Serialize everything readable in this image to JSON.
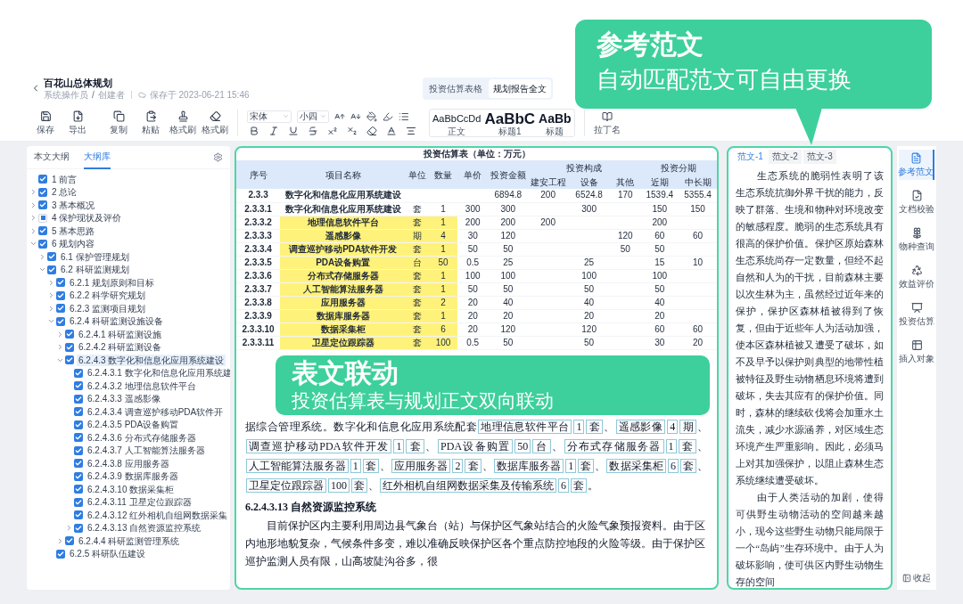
{
  "header": {
    "title": "百花山总体规划",
    "author": "系统操作员",
    "separator": "/",
    "role": "创建者",
    "saved": "保存于 2023-06-21 15:46"
  },
  "view_tabs": [
    {
      "label": "投资估算表格",
      "selected": false
    },
    {
      "label": "规划报告全文",
      "selected": true
    }
  ],
  "toolbar": {
    "buttons": [
      {
        "label": "保存",
        "kind": "save"
      },
      {
        "label": "导出",
        "kind": "export"
      },
      {
        "label": "复制",
        "kind": "copy"
      },
      {
        "label": "粘贴",
        "kind": "paste"
      },
      {
        "label": "格式刷",
        "kind": "brush"
      },
      {
        "label": "格式刷",
        "kind": "eraser"
      }
    ],
    "font": "宋体",
    "size": "小四",
    "styles": [
      {
        "preview": "AaBbCcDd",
        "label": "正文",
        "kind": "body"
      },
      {
        "preview": "AaBbC",
        "label": "标题1",
        "kind": "h1"
      },
      {
        "preview": "AaBb",
        "label": "标题",
        "kind": "h2"
      }
    ],
    "latin": "拉丁名"
  },
  "outline_tabs": [
    {
      "label": "本文大纲",
      "selected": false
    },
    {
      "label": "大纲库",
      "selected": true
    }
  ],
  "tree": [
    {
      "label": "1 前言",
      "checked": true,
      "partial": false,
      "selected": false
    },
    {
      "label": "2 总论",
      "checked": true,
      "partial": false,
      "selected": false,
      "expanded": false
    },
    {
      "label": "3 基本概况",
      "checked": true,
      "partial": false,
      "selected": false,
      "expanded": false
    },
    {
      "label": "4 保护现状及评价",
      "checked": false,
      "partial": true,
      "selected": false,
      "expanded": false
    },
    {
      "label": "5 基本思路",
      "checked": true,
      "partial": false,
      "selected": false,
      "expanded": false
    },
    {
      "label": "6 规划内容",
      "checked": true,
      "partial": false,
      "selected": false,
      "expanded": true,
      "children": [
        {
          "label": "6.1 保护管理规划",
          "checked": true,
          "partial": false,
          "selected": false,
          "expanded": false
        },
        {
          "label": "6.2 科研监测规划",
          "checked": true,
          "partial": false,
          "selected": false,
          "expanded": true,
          "children": [
            {
              "label": "6.2.1 规划原则和目标",
              "checked": true,
              "partial": false,
              "selected": false,
              "expanded": false
            },
            {
              "label": "6.2.2 科学研究规划",
              "checked": true,
              "partial": false,
              "selected": false,
              "expanded": false
            },
            {
              "label": "6.2.3 监测项目规划",
              "checked": true,
              "partial": false,
              "selected": false,
              "expanded": false
            },
            {
              "label": "6.2.4 科研监测设施设备",
              "checked": true,
              "partial": false,
              "selected": false,
              "expanded": true,
              "children": [
                {
                  "label": "6.2.4.1 科研监测设施",
                  "checked": true,
                  "partial": false,
                  "selected": false,
                  "expanded": false
                },
                {
                  "label": "6.2.4.2 科研监测设备",
                  "checked": true,
                  "partial": false,
                  "selected": false,
                  "expanded": false
                },
                {
                  "label": "6.2.4.3 数字化和信息化应用系统建设",
                  "checked": true,
                  "partial": false,
                  "selected": true,
                  "expanded": true,
                  "children": [
                    {
                      "label": "6.2.4.3.1 数字化和信息化应用系统建",
                      "checked": true,
                      "partial": false,
                      "selected": false
                    },
                    {
                      "label": "6.2.4.3.2 地理信息软件平台",
                      "checked": true,
                      "partial": false,
                      "selected": false
                    },
                    {
                      "label": "6.2.4.3.3 遥感影像",
                      "checked": true,
                      "partial": false,
                      "selected": false
                    },
                    {
                      "label": "6.2.4.3.4 调查巡护移动PDA软件开",
                      "checked": true,
                      "partial": false,
                      "selected": false
                    },
                    {
                      "label": "6.2.4.3.5 PDA设备购置",
                      "checked": true,
                      "partial": false,
                      "selected": false
                    },
                    {
                      "label": "6.2.4.3.6 分布式存储服务器",
                      "checked": true,
                      "partial": false,
                      "selected": false
                    },
                    {
                      "label": "6.2.4.3.7 人工智能算法服务器",
                      "checked": true,
                      "partial": false,
                      "selected": false
                    },
                    {
                      "label": "6.2.4.3.8 应用服务器",
                      "checked": true,
                      "partial": false,
                      "selected": false
                    },
                    {
                      "label": "6.2.4.3.9 数据库服务器",
                      "checked": true,
                      "partial": false,
                      "selected": false
                    },
                    {
                      "label": "6.2.4.3.10 数据采集柜",
                      "checked": true,
                      "partial": false,
                      "selected": false
                    },
                    {
                      "label": "6.2.4.3.11 卫星定位跟踪器",
                      "checked": true,
                      "partial": false,
                      "selected": false
                    },
                    {
                      "label": "6.2.4.3.12 红外相机自组网数据采集",
                      "checked": true,
                      "partial": false,
                      "selected": false
                    },
                    {
                      "label": "6.2.4.3.13 自然资源监控系统",
                      "checked": true,
                      "partial": false,
                      "selected": false,
                      "expanded": false
                    }
                  ]
                },
                {
                  "label": "6.2.4.4 科研监测管理系统",
                  "checked": true,
                  "partial": false,
                  "selected": false,
                  "expanded": false
                }
              ]
            },
            {
              "label": "6.2.5 科研队伍建设",
              "checked": true,
              "partial": false,
              "selected": false
            }
          ]
        }
      ]
    }
  ],
  "table": {
    "title": "投资估算表（单位：万元）",
    "columns": [
      "序号",
      "项目名称",
      "单位",
      "数量",
      "单价",
      "投资金额"
    ],
    "groups": [
      {
        "label": "投资构成",
        "columns": [
          "建安工程",
          "设备",
          "其他"
        ]
      },
      {
        "label": "投资分期",
        "columns": [
          "近期",
          "中长期"
        ]
      }
    ],
    "rows": [
      {
        "highlighted": false,
        "cells": [
          "2.3.3",
          "数字化和信息化应用系统建设",
          null,
          null,
          null,
          "6894.8",
          "200",
          "6524.8",
          "170",
          "1539.4",
          "5355.4"
        ]
      },
      {
        "highlighted": false,
        "cells": [
          "2.3.3.1",
          "数字化和信息化应用系统建设",
          "套",
          "1",
          "300",
          "300",
          null,
          "300",
          null,
          "150",
          "150"
        ]
      },
      {
        "highlighted": true,
        "cells": [
          "2.3.3.2",
          "地理信息软件平台",
          "套",
          "1",
          "200",
          "200",
          "200",
          null,
          null,
          "200",
          null
        ]
      },
      {
        "highlighted": true,
        "cells": [
          "2.3.3.3",
          "遥感影像",
          "期",
          "4",
          "30",
          "120",
          null,
          null,
          "120",
          "60",
          "60"
        ]
      },
      {
        "highlighted": true,
        "cells": [
          "2.3.3.4",
          "调查巡护移动PDA软件开发",
          "套",
          "1",
          "50",
          "50",
          null,
          null,
          "50",
          "50",
          null
        ]
      },
      {
        "highlighted": true,
        "cells": [
          "2.3.3.5",
          "PDA设备购置",
          "台",
          "50",
          "0.5",
          "25",
          null,
          "25",
          null,
          "15",
          "10"
        ]
      },
      {
        "highlighted": true,
        "cells": [
          "2.3.3.6",
          "分布式存储服务器",
          "套",
          "1",
          "100",
          "100",
          null,
          "100",
          null,
          "100",
          null
        ]
      },
      {
        "highlighted": true,
        "cells": [
          "2.3.3.7",
          "人工智能算法服务器",
          "套",
          "1",
          "50",
          "50",
          null,
          "50",
          null,
          "50",
          null
        ]
      },
      {
        "highlighted": true,
        "cells": [
          "2.3.3.8",
          "应用服务器",
          "套",
          "2",
          "20",
          "40",
          null,
          "40",
          null,
          "40",
          null
        ]
      },
      {
        "highlighted": true,
        "cells": [
          "2.3.3.9",
          "数据库服务器",
          "套",
          "1",
          "20",
          "20",
          null,
          "20",
          null,
          "20",
          null
        ]
      },
      {
        "highlighted": true,
        "cells": [
          "2.3.3.10",
          "数据采集柜",
          "套",
          "6",
          "20",
          "120",
          null,
          "120",
          null,
          "60",
          "60"
        ]
      },
      {
        "highlighted": true,
        "cells": [
          "2.3.3.11",
          "卫星定位跟踪器",
          "套",
          "100",
          "0.5",
          "50",
          null,
          "50",
          null,
          "30",
          "20"
        ]
      }
    ]
  },
  "document": {
    "lead": "据综合管理系统。数字化和信息化应用系统配套",
    "items": [
      {
        "name": "地理信息软件平台",
        "qty": "1",
        "unit": "套"
      },
      {
        "name": "遥感影像",
        "qty": "4",
        "unit": "期"
      },
      {
        "name": "调查巡护移动PDA软件开发",
        "qty": "1",
        "unit": "套"
      },
      {
        "name": "PDA设备购置",
        "qty": "50",
        "unit": "台"
      },
      {
        "name": "分布式存储服务器",
        "qty": "1",
        "unit": "套"
      },
      {
        "name": "人工智能算法服务器",
        "qty": "1",
        "unit": "套"
      },
      {
        "name": "应用服务器",
        "qty": "2",
        "unit": "套"
      },
      {
        "name": "数据库服务器",
        "qty": "1",
        "unit": "套"
      },
      {
        "name": "数据采集柜",
        "qty": "6",
        "unit": "套"
      },
      {
        "name": "卫星定位跟踪器",
        "qty": "100",
        "unit": "套"
      },
      {
        "name": "红外相机自组网数据采集及传输系统",
        "qty": "6",
        "unit": "套"
      }
    ],
    "separator": "、",
    "end": "。",
    "heading": "6.2.4.3.13 自然资源监控系统",
    "paragraph": "目前保护区内主要利用周边县气象台（站）与保护区气象站结合的火险气象预报资料。由于区内地形地貌复杂，气候条件多变，难以准确反映保护区各个重点防控地段的火险等级。由于保护区巡护监测人员有限，山高坡陡沟谷多，很"
  },
  "sample_tabs": [
    {
      "label": "范文-1",
      "selected": true
    },
    {
      "label": "范文-2",
      "selected": false
    },
    {
      "label": "范文-3",
      "selected": false
    }
  ],
  "sample_text": [
    "生态系统的脆弱性表明了该生态系统抗御外界干扰的能力，反映了群落、生境和物种对环境改变的敏感程度。脆弱的生态系统具有很高的保护价值。保护区原始森林生态系统尚存一定数量，但经不起自然和人为的干扰，目前森林主要以次生林为主，虽然经过近年来的保护，保护区森林植被得到了恢复，但由于近些年人为活动加强，使本区森林植被又遭受了破坏，如不及早予以保护则典型的地带性植被特征及野生动物栖息环境将遭到破坏，失去其应有的保护价值。同时，森林的继续砍伐将会加重水土流失，减少水源涵养，对区域生态环境产生严重影响。因此，必须马上对其加强保护，以阻止森林生态系统继续遭受破坏。",
    "由于人类活动的加剧，使得可供野生动物活动的空间越来越小，现今这些野生动物只能局限于一个“岛屿”生存环境中。由于人为破坏影响，使可供区内野生动物生存的空间"
  ],
  "side_tools": [
    {
      "label": "参考范文",
      "kind": "sample",
      "selected": true
    },
    {
      "label": "文档校验",
      "kind": "check",
      "selected": false
    },
    {
      "label": "物种查询",
      "kind": "species",
      "selected": false
    },
    {
      "label": "效益评价",
      "kind": "benefit",
      "selected": false
    },
    {
      "label": "投资估算",
      "kind": "invest",
      "selected": false
    },
    {
      "label": "插入对象",
      "kind": "insert",
      "selected": false
    }
  ],
  "collapse": "收起",
  "callouts": [
    {
      "title": "参考范文",
      "subtitle": "自动匹配范文可自由更换"
    },
    {
      "title": "表文联动",
      "subtitle": "投资估算表与规划正文双向联动"
    }
  ]
}
